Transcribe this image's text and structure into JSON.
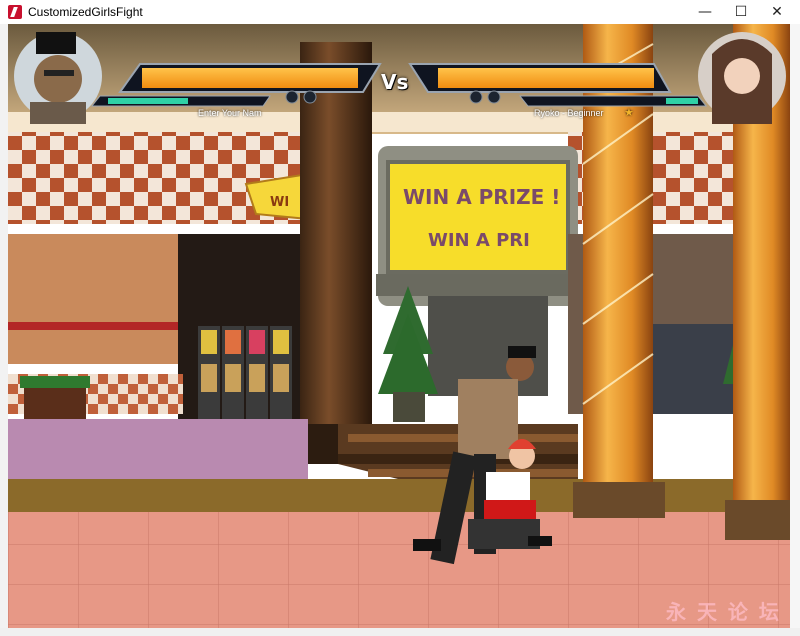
{
  "window": {
    "title": "CustomizedGirlsFight",
    "minimize_glyph": "—",
    "maximize_glyph": "☐",
    "close_glyph": "✕"
  },
  "hud": {
    "vs_label": "Vs",
    "player1": {
      "name": "Enter Your  Nam",
      "health": 1.0,
      "energy": 0.5
    },
    "player2": {
      "name": "Ryoko - Beginner",
      "health": 1.0,
      "energy": 0.2,
      "star_glyph": "★"
    }
  },
  "scene": {
    "sign_text_1": "WIN A PRIZE !",
    "sign_text_2": "WIN A PRI",
    "sign_text_left": "WI"
  },
  "colors": {
    "health_bar": "#f7a21a",
    "energy_bar": "#2fd1a6",
    "pillar": "#f0a13a",
    "floor": "#e69a86"
  },
  "icons": {
    "app": "app-logo-icon",
    "star": "star-icon"
  }
}
